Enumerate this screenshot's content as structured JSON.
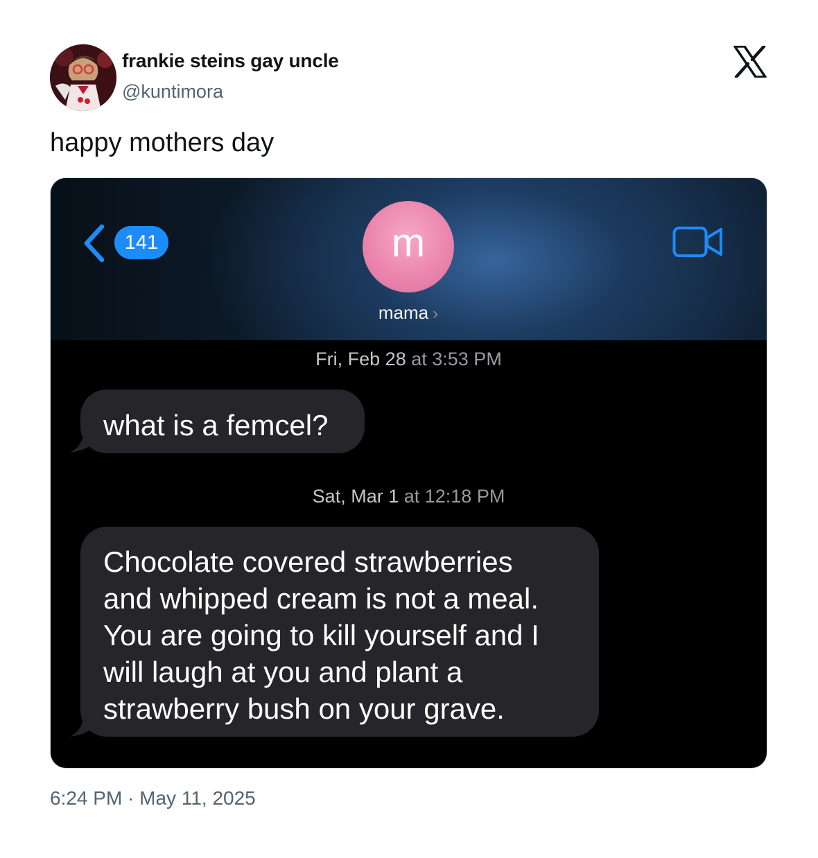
{
  "tweet": {
    "author_name": "frankie steins gay uncle",
    "author_handle": "@kuntimora",
    "text": "happy mothers day",
    "timestamp": "6:24 PM · May 11, 2025"
  },
  "icons": {
    "platform_logo": "x-logo-icon",
    "back": "chevron-left-icon",
    "video": "video-camera-icon"
  },
  "messages_screenshot": {
    "unread_count": "141",
    "contact_initial": "m",
    "contact_name": "mama",
    "thread": [
      {
        "timestamp_day": "Fri, Feb 28",
        "timestamp_time": "at 3:53 PM",
        "message": "what is a femcel?"
      },
      {
        "timestamp_day": "Sat, Mar 1",
        "timestamp_time": "at 12:18 PM",
        "message_lines": [
          "Chocolate covered strawberries",
          "and whipped cream is not a meal.",
          "You are going to kill yourself and I",
          "will laugh at you and plant a",
          "strawberry bush on your grave."
        ]
      }
    ]
  },
  "colors": {
    "ios_blue": "#1d8cf8",
    "bubble_gray": "#26262a",
    "contact_pink": "#ec86ad",
    "secondary_text": "#536471"
  }
}
